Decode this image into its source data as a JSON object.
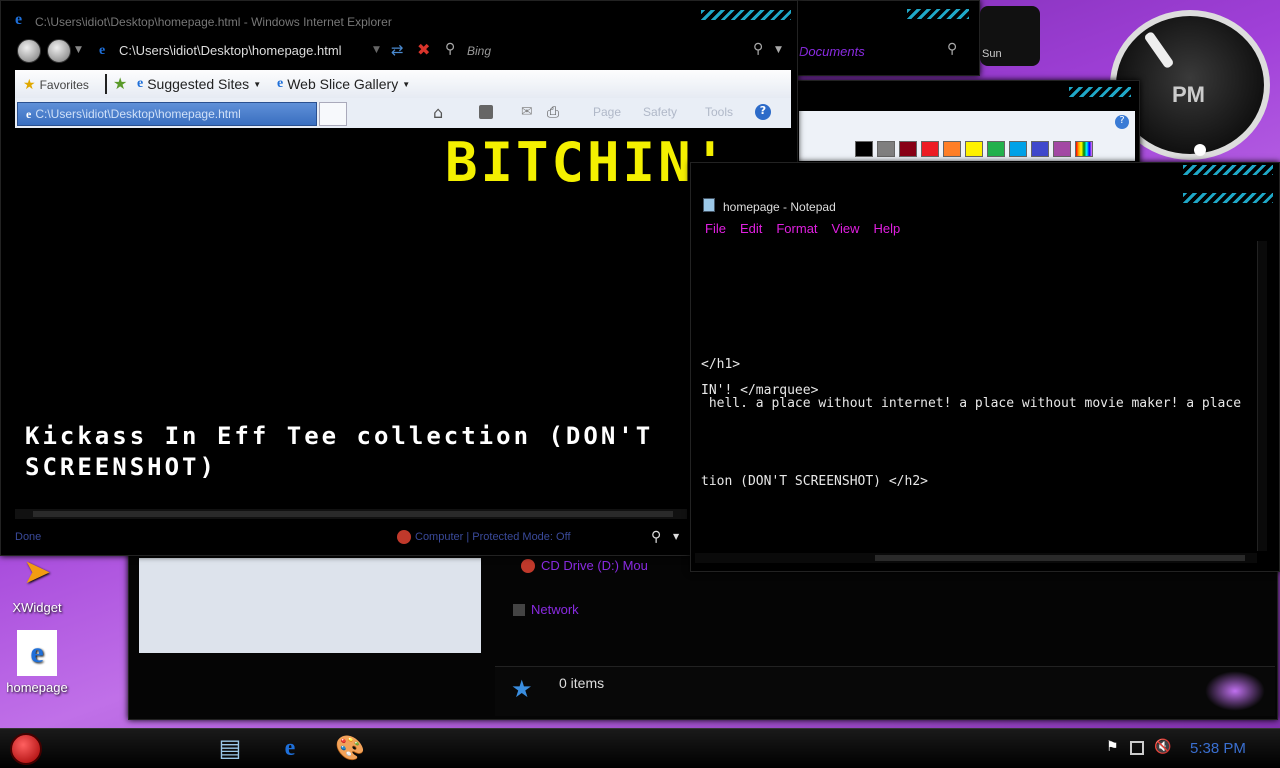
{
  "desktop": {
    "icons": [
      {
        "label": "XWidget"
      },
      {
        "label": "homepage"
      }
    ]
  },
  "clock_widget": {
    "ampm": "PM",
    "day": "Sun"
  },
  "ie": {
    "title": "C:\\Users\\idiot\\Desktop\\homepage.html - Windows Internet Explorer",
    "address": "C:\\Users\\idiot\\Desktop\\homepage.html",
    "search_placeholder": "Bing",
    "favorites_label": "Favorites",
    "suggested_sites": "Suggested Sites",
    "web_slice": "Web Slice Gallery",
    "tab_label": "C:\\Users\\idiot\\Desktop\\homepage.html",
    "cmd_page": "Page",
    "cmd_safety": "Safety",
    "cmd_tools": "Tools",
    "content_marquee": "BITCHIN'",
    "content_h2": "Kickass In Eff Tee collection (DON'T SCREENSHOT)",
    "status_left": "Done",
    "status_zone": "Computer | Protected Mode: Off"
  },
  "explorer": {
    "documents_link": "Documents",
    "cd_drive": "CD Drive (D:) Mou",
    "network": "Network",
    "items_count": "0 items"
  },
  "notepad": {
    "title": "homepage - Notepad",
    "menu": [
      "File",
      "Edit",
      "Format",
      "View",
      "Help"
    ],
    "lines": [
      "</h1>",
      "IN'! </marquee>",
      " hell. a place without internet! a place without movie maker! a place",
      "tion (DON'T SCREENSHOT) </h2>"
    ]
  },
  "paint": {
    "colors": [
      "#000000",
      "#7f7f7f",
      "#880015",
      "#ed1c24",
      "#ff7f27",
      "#fff200",
      "#22b14c",
      "#00a2e8",
      "#3f48cc",
      "#a349a4"
    ]
  },
  "taskbar": {
    "time": "5:38 PM"
  }
}
